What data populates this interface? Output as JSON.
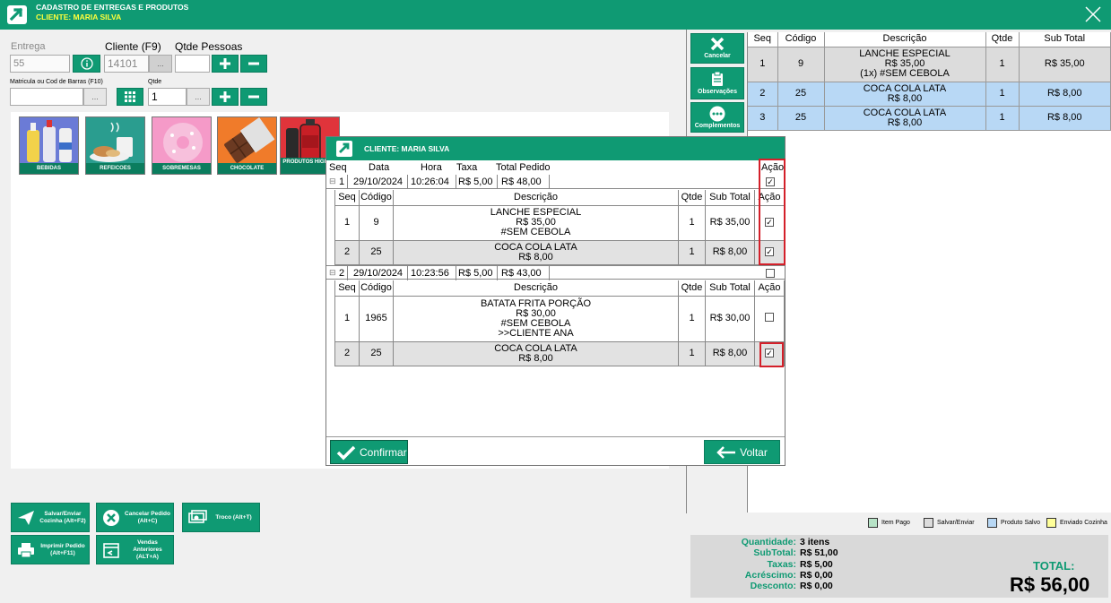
{
  "window": {
    "title": "CADASTRO DE ENTREGAS E PRODUTOS",
    "client": "CLIENTE: MARIA SILVA"
  },
  "form": {
    "entrega_label": "Entrega",
    "entrega_value": "55",
    "cliente_label": "Cliente (F9)",
    "cliente_value": "14101",
    "qtde_pessoas_label": "Qtde Pessoas",
    "qtde_pessoas_value": "",
    "matricula_label": "Matricula ou Cod de Barras (F10)",
    "matricula_value": "",
    "qtde_label": "Qtde",
    "qtde_value": "1",
    "ellipsis": "..."
  },
  "categories": [
    {
      "label": "BEBIDAS",
      "color": "#6b7bd6"
    },
    {
      "label": "REFEICOES",
      "color": "#2a9d8f"
    },
    {
      "label": "SOBREMESAS",
      "color": "#f59ac8"
    },
    {
      "label": "CHOCOLATE",
      "color": "#f07b2a"
    },
    {
      "label": "PRODUTOS HIGIENE",
      "color": "#e0343b"
    }
  ],
  "actions": {
    "salvar": "Salvar/Enviar Cozinha (Alt+F2)",
    "cancelar_pedido": "Cancelar Pedido (Alt+C)",
    "troco": "Troco (Alt+T)",
    "imprimir": "Imprimir Pedido (Alt+F11)",
    "vendas_anteriores": "Vendas Anteriores (ALT+A)"
  },
  "side": {
    "cancelar": "Cancelar",
    "observacoes": "Observações",
    "complementos": "Complementos"
  },
  "grid": {
    "headers": [
      "Seq",
      "Código",
      "Descrição",
      "Qtde",
      "Sub Total"
    ],
    "rows": [
      {
        "seq": "1",
        "codigo": "9",
        "d1": "LANCHE ESPECIAL",
        "d2": "R$ 35,00",
        "d3": "(1x) #SEM CEBOLA",
        "qtde": "1",
        "subtotal": "R$ 35,00",
        "color": "#dcdcdc"
      },
      {
        "seq": "2",
        "codigo": "25",
        "d1": "COCA COLA LATA",
        "d2": "R$ 8,00",
        "d3": "",
        "qtde": "1",
        "subtotal": "R$ 8,00",
        "color": "#b8d8f5"
      },
      {
        "seq": "3",
        "codigo": "25",
        "d1": "COCA COLA LATA",
        "d2": "R$ 8,00",
        "d3": "",
        "qtde": "1",
        "subtotal": "R$ 8,00",
        "color": "#b8d8f5"
      }
    ]
  },
  "legend": [
    {
      "label": "Item Pago",
      "color": "#b7e3c7"
    },
    {
      "label": "Salvar/Enviar",
      "color": "#dcdcdc"
    },
    {
      "label": "Produto Salvo",
      "color": "#b8d8f5"
    },
    {
      "label": "Enviado Cozinha",
      "color": "#ffff99"
    }
  ],
  "totals": {
    "quantidade_label": "Quantidade:",
    "quantidade": "3 itens",
    "subtotal_label": "SubTotal:",
    "subtotal": "R$ 51,00",
    "taxas_label": "Taxas:",
    "taxas": "R$ 5,00",
    "acrescimo_label": "Acréscimo:",
    "acrescimo": "R$ 0,00",
    "desconto_label": "Desconto:",
    "desconto": "R$ 0,00",
    "total_label": "TOTAL:",
    "total": "R$ 56,00"
  },
  "dialog": {
    "title": "CLIENTE: MARIA SILVA",
    "headers": [
      "Seq",
      "Data",
      "Hora",
      "Taxa",
      "Total Pedido",
      "Ação"
    ],
    "sub_headers": [
      "Seq",
      "Código",
      "Descrição",
      "Qtde",
      "Sub Total",
      "Ação"
    ],
    "orders": [
      {
        "seq": "1",
        "data": "29/10/2024",
        "hora": "10:26:04",
        "taxa": "R$ 5,00",
        "total": "R$ 48,00",
        "checked": true,
        "items": [
          {
            "seq": "1",
            "codigo": "9",
            "d1": "LANCHE ESPECIAL",
            "d2": "R$ 35,00",
            "d3": "#SEM CEBOLA",
            "d4": "",
            "qtde": "1",
            "subtotal": "R$ 35,00",
            "checked": true
          },
          {
            "seq": "2",
            "codigo": "25",
            "d1": "COCA COLA LATA",
            "d2": "R$ 8,00",
            "d3": "",
            "d4": "",
            "qtde": "1",
            "subtotal": "R$ 8,00",
            "checked": true
          }
        ]
      },
      {
        "seq": "2",
        "data": "29/10/2024",
        "hora": "10:23:56",
        "taxa": "R$ 5,00",
        "total": "R$ 43,00",
        "checked": false,
        "items": [
          {
            "seq": "1",
            "codigo": "1965",
            "d1": "BATATA FRITA PORÇÃO",
            "d2": "R$ 30,00",
            "d3": "#SEM CEBOLA",
            "d4": ">>CLIENTE ANA",
            "qtde": "1",
            "subtotal": "R$ 30,00",
            "checked": false
          },
          {
            "seq": "2",
            "codigo": "25",
            "d1": "COCA COLA LATA",
            "d2": "R$ 8,00",
            "d3": "",
            "d4": "",
            "qtde": "1",
            "subtotal": "R$ 8,00",
            "checked": true
          }
        ]
      }
    ],
    "confirmar": "Confirmar",
    "voltar": "Voltar"
  }
}
